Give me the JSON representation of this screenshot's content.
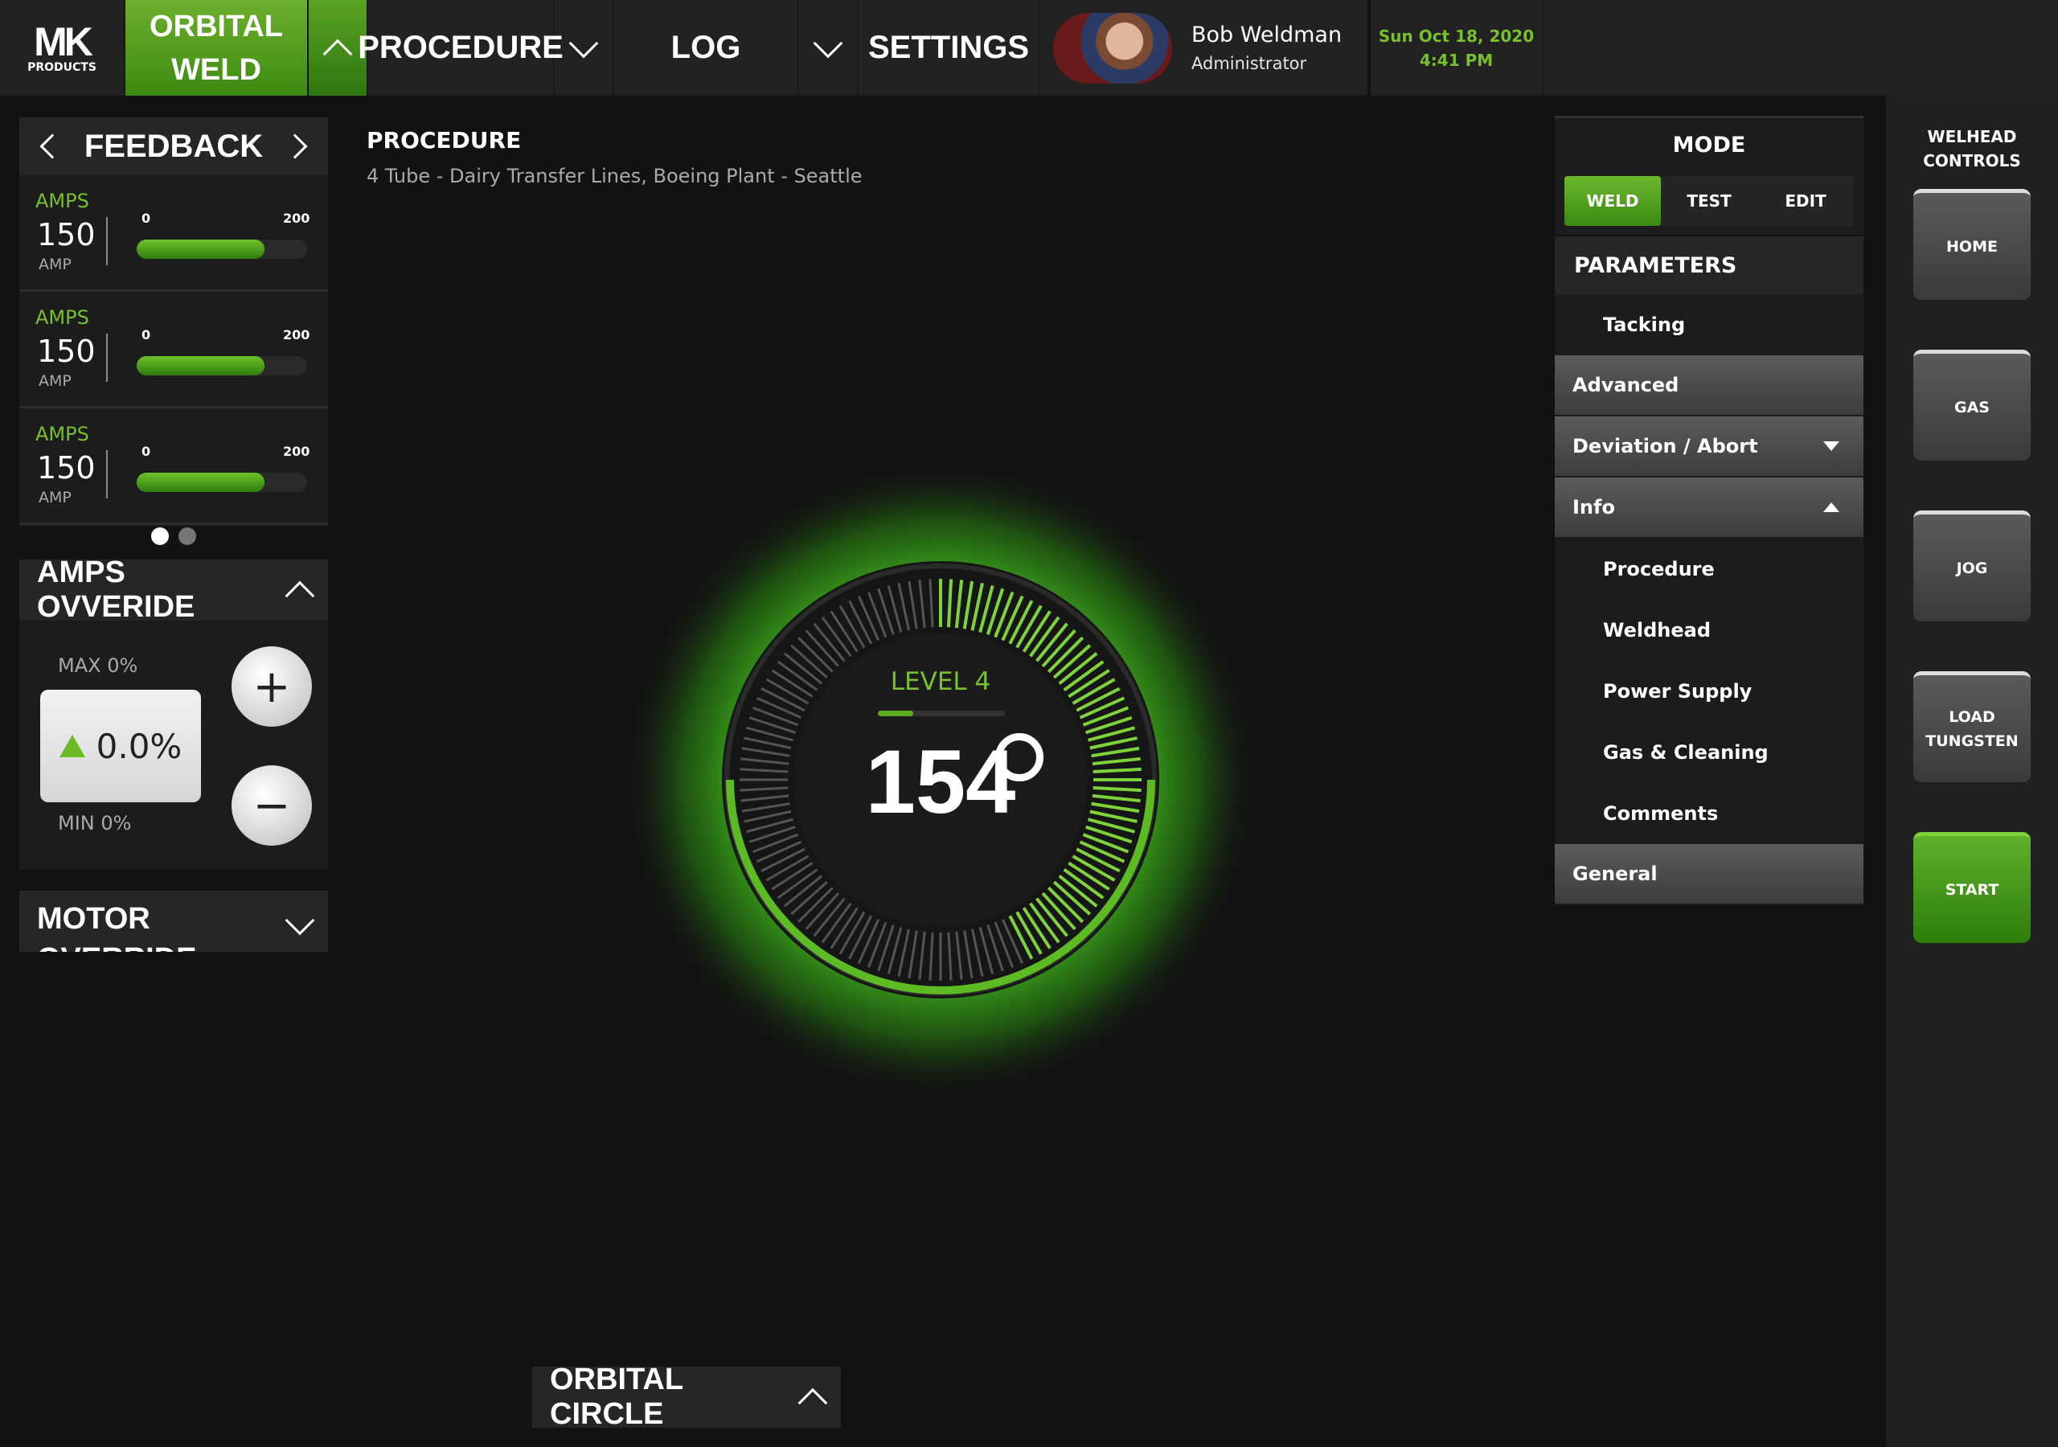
{
  "nav": {
    "logo_text": "MK",
    "logo_sub": "PRODUCTS",
    "orbital_line1": "ORBITAL",
    "orbital_line2": "WELD",
    "procedure": "PROCEDURE",
    "log": "LOG",
    "settings": "SETTINGS",
    "user_name": "Bob Weldman",
    "user_role": "Administrator",
    "date": "Sun Oct 18, 2020",
    "time": "4:41 PM"
  },
  "feedback": {
    "title": "FEEDBACK",
    "rows": [
      {
        "label": "AMPS",
        "value": "150",
        "unit": "AMP",
        "min": "0",
        "max": "200",
        "level": 0.75
      },
      {
        "label": "AMPS",
        "value": "150",
        "unit": "AMP",
        "min": "0",
        "max": "200",
        "level": 0.75
      },
      {
        "label": "AMPS",
        "value": "150",
        "unit": "AMP",
        "min": "0",
        "max": "200",
        "level": 0.75
      }
    ],
    "page": 1,
    "pages": 2
  },
  "override": {
    "title": "AMPS OVVERIDE",
    "max_label": "MAX 0%",
    "min_label": "MIN 0%",
    "value": "0.0%",
    "plus": "+",
    "minus": "−"
  },
  "motor": {
    "title": "MOTOR OVERRIDE"
  },
  "procedure": {
    "heading": "PROCEDURE",
    "description": "4 Tube - Dairy Transfer Lines, Boeing Plant - Seattle"
  },
  "gauge": {
    "level_label": "LEVEL 4",
    "level_fraction": 0.28,
    "degrees": "154",
    "angle_value": 154
  },
  "orbital_circle": {
    "title": "ORBITAL CIRCLE"
  },
  "mode": {
    "title": "MODE",
    "tabs": [
      "WELD",
      "TEST",
      "EDIT"
    ],
    "selected": "WELD"
  },
  "parameters": {
    "title": "PARAMETERS",
    "tacking": "Tacking",
    "advanced": "Advanced",
    "deviation": "Deviation / Abort",
    "info": "Info",
    "info_items": [
      "Procedure",
      "Weldhead",
      "Power Supply",
      "Gas & Cleaning",
      "Comments"
    ],
    "general": "General"
  },
  "rail": {
    "title_line1": "WELHEAD",
    "title_line2": "CONTROLS",
    "home": "HOME",
    "gas": "GAS",
    "jog": "JOG",
    "load_line1": "LOAD",
    "load_line2": "TUNGSTEN",
    "start": "START"
  },
  "colors": {
    "accent": "#78c02c",
    "accent_dark": "#3d8a12",
    "panel": "#1c1c1c",
    "bg": "#121212"
  }
}
